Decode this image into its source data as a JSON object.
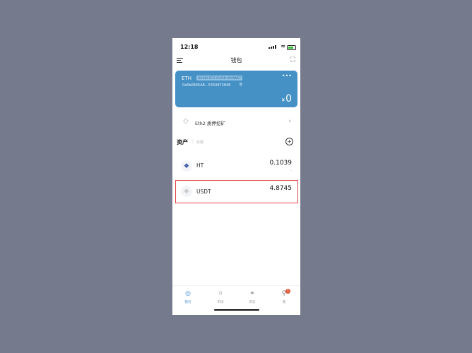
{
  "status_bar": {
    "time": "12:18"
  },
  "header": {
    "title": "钱包",
    "menu_icon": "menu-icon",
    "scan_icon": "scan-icon"
  },
  "wallet_card": {
    "coin": "ETH",
    "network_tag": "HUOBI ECO CHAIN MAINNET",
    "address": "0x6b0845A8...535087284E",
    "currency_symbol": "¥",
    "balance": "0",
    "color": "#4590c4"
  },
  "staking": {
    "label": "Eth2 质押挖矿"
  },
  "assets": {
    "heading": "资产",
    "subheading": "收藏",
    "items": [
      {
        "name": "HT",
        "amount": "0.1039",
        "fiat": "-"
      },
      {
        "name": "USDT",
        "amount": "4.8745",
        "fiat": ""
      }
    ]
  },
  "tabbar": {
    "tabs": [
      {
        "label": "钱包",
        "icon": "wallet-icon",
        "active": true
      },
      {
        "label": "市场",
        "icon": "market-icon",
        "active": false
      },
      {
        "label": "浏览",
        "icon": "browser-icon",
        "active": false
      },
      {
        "label": "我",
        "icon": "profile-icon",
        "active": false,
        "badge": "1"
      }
    ]
  },
  "accent_color": "#3d8ad6",
  "highlight_color": "#e0464a"
}
